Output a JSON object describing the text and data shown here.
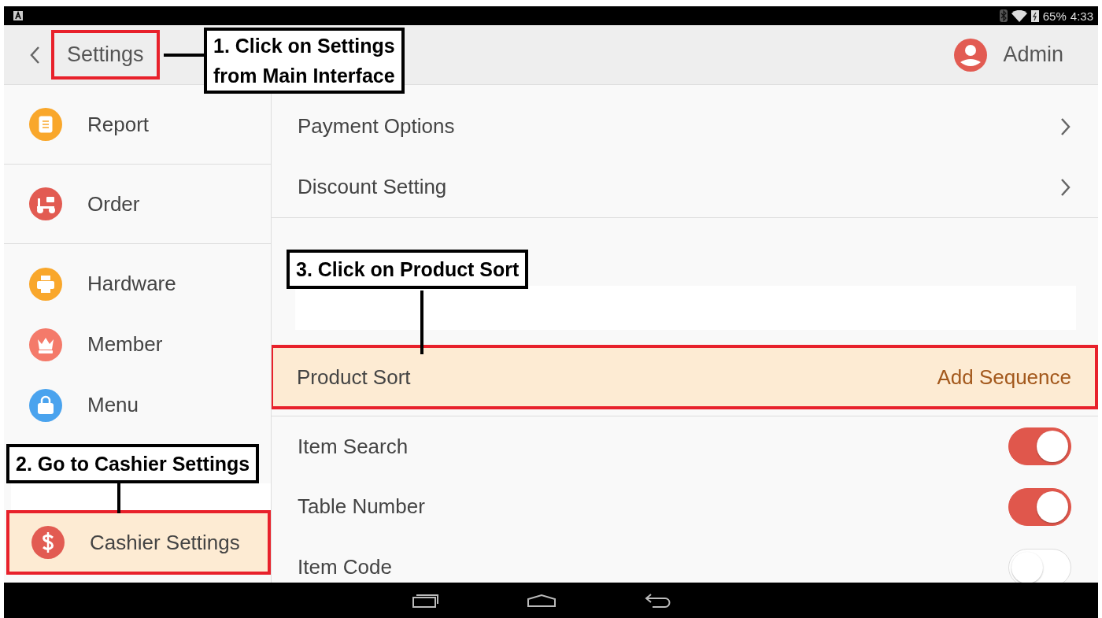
{
  "status_bar": {
    "battery": "65%",
    "time": "4:33"
  },
  "header": {
    "title": "Settings",
    "title_highlighted": true,
    "user": "Admin"
  },
  "sidebar": {
    "sections": [
      [
        {
          "label": "Report",
          "color": "#f9a72b",
          "selected": false
        }
      ],
      [
        {
          "label": "Order",
          "color": "#e25b52",
          "selected": false
        }
      ],
      [
        {
          "label": "Hardware",
          "color": "#f9a72b",
          "selected": false
        },
        {
          "label": "Member",
          "color": "#f47a6a",
          "selected": false
        },
        {
          "label": "Menu",
          "color": "#4aa3ee",
          "selected": false
        },
        {
          "label": "Cashier Settings",
          "color": "#e25b52",
          "selected": true
        }
      ]
    ]
  },
  "content": {
    "rows": [
      {
        "kind": "link",
        "label": "Payment Options",
        "selected": false
      },
      {
        "kind": "link",
        "label": "Discount Setting",
        "selected": false
      },
      {
        "kind": "blank"
      },
      {
        "kind": "action",
        "label": "Product Sort",
        "value": "Add Sequence",
        "selected": true
      },
      {
        "kind": "toggle",
        "label": "Item Search",
        "on": true,
        "selected": false
      },
      {
        "kind": "toggle",
        "label": "Table Number",
        "on": true,
        "selected": false
      },
      {
        "kind": "toggle",
        "label": "Item Code",
        "on": false,
        "selected": false
      }
    ]
  },
  "annotations": [
    "1. Click on Settings\nfrom Main Interface",
    "2. Go to Cashier Settings",
    "3. Click on Product Sort"
  ]
}
